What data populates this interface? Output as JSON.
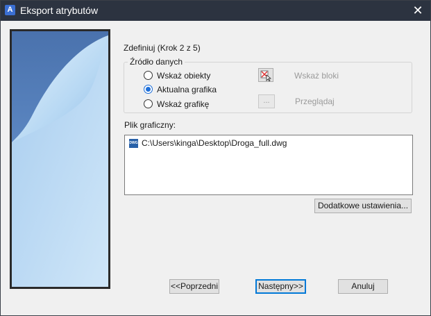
{
  "window": {
    "title": "Eksport atrybutów",
    "close_glyph": "✕"
  },
  "step": "Zdefiniuj (Krok 2 z 5)",
  "source_group": {
    "title": "Źródło danych",
    "options": [
      {
        "label": "Wskaż obiekty",
        "checked": false
      },
      {
        "label": "Aktualna grafika",
        "checked": true
      },
      {
        "label": "Wskaż grafikę",
        "checked": false
      }
    ],
    "pick_blocks_label": "Wskaż bloki",
    "browse_button": "...",
    "browse_label": "Przeglądaj"
  },
  "graphic_file": {
    "label": "Plik graficzny:",
    "icon_text": "DWG",
    "path": "C:\\Users\\kinga\\Desktop\\Droga_full.dwg"
  },
  "buttons": {
    "additional_settings": "Dodatkowe ustawienia...",
    "previous": "<<Poprzedni",
    "next": "Następny>>",
    "cancel": "Anuluj"
  },
  "icons": {
    "app": "attribute-export-app-icon",
    "pick_blocks": "pick-cursor-icon",
    "file": "dwg-file-icon"
  },
  "colors": {
    "titlebar": "#2c3340",
    "accent": "#1e6fd9",
    "side_dark": "#4a72ad",
    "side_light": "#c6e0f5"
  }
}
